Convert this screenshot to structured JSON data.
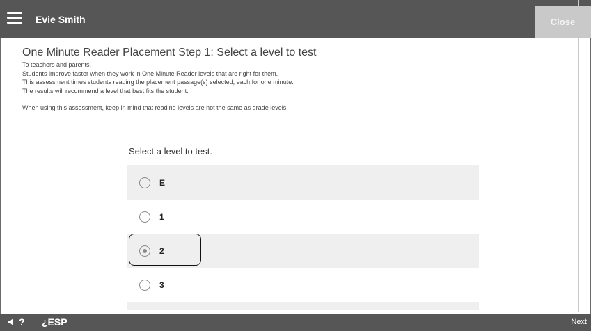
{
  "header": {
    "user_name": "Evie Smith",
    "close_label": "Close"
  },
  "main": {
    "title": "One Minute Reader Placement Step 1: Select a level to test",
    "intro_lines": [
      "To teachers and parents,",
      "Students improve faster when they work in One Minute Reader levels that are right for them.",
      "This assessment times students reading the placement passage(s) selected, each for one minute.",
      "The results will recommend a level that best fits the student."
    ],
    "note": "When using this assessment, keep in mind that reading levels are not the same as grade levels.",
    "prompt": "Select a level to test.",
    "options": [
      {
        "label": "E",
        "selected": false
      },
      {
        "label": "1",
        "selected": false
      },
      {
        "label": "2",
        "selected": true
      },
      {
        "label": "3",
        "selected": false
      }
    ]
  },
  "footer": {
    "audio_label": "?",
    "language_label": "¿ESP",
    "next_label": "Next"
  },
  "icons": {
    "menu": "hamburger-menu-icon",
    "audio": "speaker-icon",
    "radio_empty": "radio-unchecked-icon",
    "radio_selected": "radio-checked-icon"
  }
}
